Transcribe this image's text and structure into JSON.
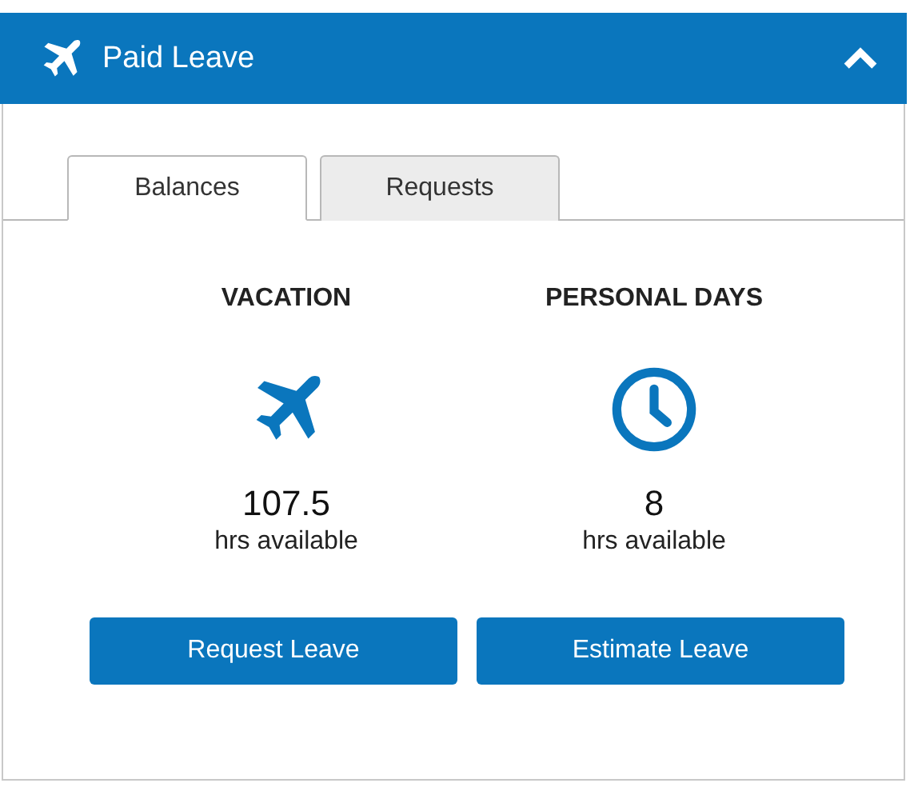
{
  "panel": {
    "title": "Paid Leave",
    "expanded": true
  },
  "tabs": [
    {
      "label": "Balances",
      "selected": true
    },
    {
      "label": "Requests",
      "selected": false
    }
  ],
  "balances": [
    {
      "kind": "plane",
      "title": "VACATION",
      "value": "107.5",
      "unit": "hrs available"
    },
    {
      "kind": "clock",
      "title": "PERSONAL DAYS",
      "value": "8",
      "unit": "hrs available"
    }
  ],
  "buttons": [
    "Request Leave",
    "Estimate Leave"
  ]
}
